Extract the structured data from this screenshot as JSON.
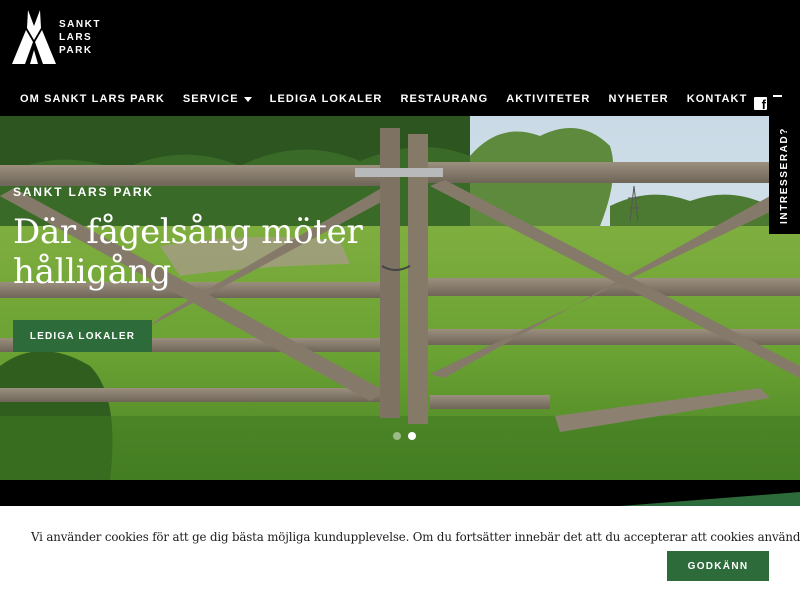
{
  "logo": {
    "lines": [
      "SANKT",
      "LARS",
      "PARK"
    ]
  },
  "nav": {
    "items": [
      {
        "label": "OM SANKT LARS PARK"
      },
      {
        "label": "SERVICE",
        "has_dropdown": true
      },
      {
        "label": "LEDIGA LOKALER"
      },
      {
        "label": "RESTAURANG"
      },
      {
        "label": "AKTIVITETER"
      },
      {
        "label": "NYHETER"
      },
      {
        "label": "KONTAKT"
      }
    ]
  },
  "social": {
    "icon": "facebook-icon",
    "glyph": "f"
  },
  "side_tab": {
    "label": "INTRESSERAD?"
  },
  "hero": {
    "eyebrow": "SANKT LARS PARK",
    "title_line1": "Där fågelsång möter",
    "title_line2": "hålligång",
    "button_label": "LEDIGA LOKALER",
    "slides": {
      "count": 2,
      "active": 2
    }
  },
  "cookie": {
    "message": "Vi använder cookies för att ge dig bästa möjliga kundupplevelse. Om du fortsätter innebär det att du accepterar att cookies används.",
    "accept_label": "GODKÄNN"
  },
  "colors": {
    "header_bg": "#000000",
    "accent_green": "#2e6b3a",
    "cookie_bg": "#ffffff",
    "text_dark": "#1c1c1c"
  }
}
